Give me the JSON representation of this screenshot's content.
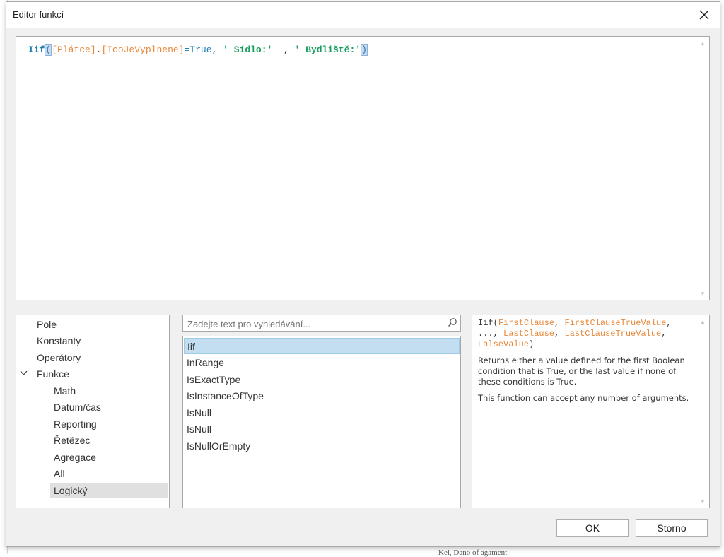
{
  "dialog": {
    "title": "Editor funkcí"
  },
  "expression": {
    "func": "Iif",
    "open": "(",
    "field1": "[Plátce]",
    "dot": ".",
    "field2": "[IcoJeVyplnene]",
    "cond_rest": "=True,",
    "str1": "' Sídlo:'",
    "sep": "  ,",
    "str2": "' Bydliště:'",
    "close": ")"
  },
  "categories": {
    "items": [
      "Pole",
      "Konstanty",
      "Operátory",
      "Funkce"
    ],
    "subitems": [
      "Math",
      "Datum/čas",
      "Reporting",
      "Řetězec",
      "Agregace",
      "All",
      "Logický"
    ],
    "selected": "Logický"
  },
  "search": {
    "placeholder": "Zadejte text pro vyhledávání..."
  },
  "functions": {
    "items": [
      "Iif",
      "InRange",
      "IsExactType",
      "IsInstanceOfType",
      "IsNull",
      "IsNull",
      "IsNullOrEmpty"
    ],
    "selected": "Iif"
  },
  "description": {
    "sig_name": "Iif(",
    "arg1": "FirstClause",
    "comma1": ", ",
    "arg2": "FirstClauseTrueValue",
    "comma2": ",",
    "ellipsis": "..., ",
    "arg3": "LastClause",
    "comma3": ", ",
    "arg4": "LastClauseTrueValue",
    "comma4": ",",
    "arg5": "FalseValue",
    "sig_close": ")",
    "para1": "Returns either a value defined for the first Boolean condition that is True, or the last value if none of these conditions is True.",
    "para2": "This function can accept any number of arguments."
  },
  "buttons": {
    "ok": "OK",
    "cancel": "Storno"
  },
  "icons": {
    "close": "close-icon",
    "search": "search-icon",
    "expand": "chevron-down-icon"
  },
  "background": {
    "bottom_text": "Kel, Dano of agament"
  }
}
